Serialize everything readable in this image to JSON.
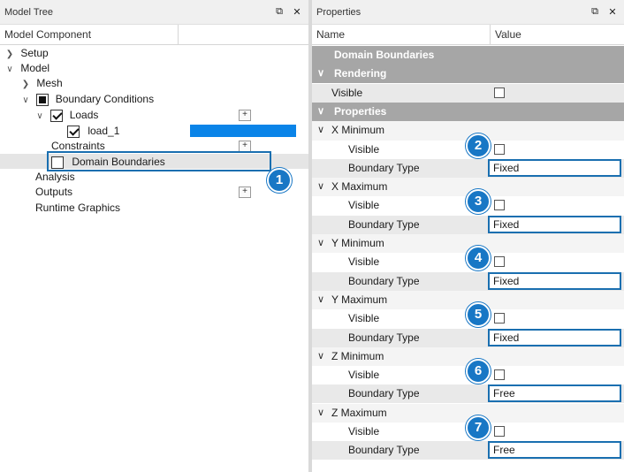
{
  "left": {
    "title": "Model Tree",
    "column": "Model Component",
    "tree": {
      "setup": "Setup",
      "model": "Model",
      "mesh": "Mesh",
      "boundary_conditions": "Boundary Conditions",
      "loads": "Loads",
      "load_1": "load_1",
      "constraints": "Constraints",
      "domain_boundaries": "Domain Boundaries",
      "analysis": "Analysis",
      "outputs": "Outputs",
      "runtime_graphics": "Runtime Graphics"
    },
    "plus": "+",
    "load_color": "#0a84e8",
    "callout_1": "1"
  },
  "right": {
    "title": "Properties",
    "col_name": "Name",
    "col_value": "Value",
    "header_row": "Domain Boundaries",
    "rendering": "Rendering",
    "visible": "Visible",
    "properties": "Properties",
    "boundary_type": "Boundary Type",
    "groups": [
      {
        "name": "X Minimum",
        "boundary": "Fixed",
        "callout": "2"
      },
      {
        "name": "X Maximum",
        "boundary": "Fixed",
        "callout": "3"
      },
      {
        "name": "Y Minimum",
        "boundary": "Fixed",
        "callout": "4"
      },
      {
        "name": "Y Maximum",
        "boundary": "Fixed",
        "callout": "5"
      },
      {
        "name": "Z Minimum",
        "boundary": "Free",
        "callout": "6"
      },
      {
        "name": "Z Maximum",
        "boundary": "Free",
        "callout": "7"
      }
    ]
  },
  "icons": {
    "float": "float-window-icon",
    "close": "close-icon",
    "chevron_right": "chevron-right-icon",
    "chevron_down": "chevron-down-icon"
  },
  "colors": {
    "accent": "#1877c5",
    "section": "#a6a6a6",
    "alt_row": "#e9e9e9",
    "highlight_border": "#1a6fb0"
  }
}
